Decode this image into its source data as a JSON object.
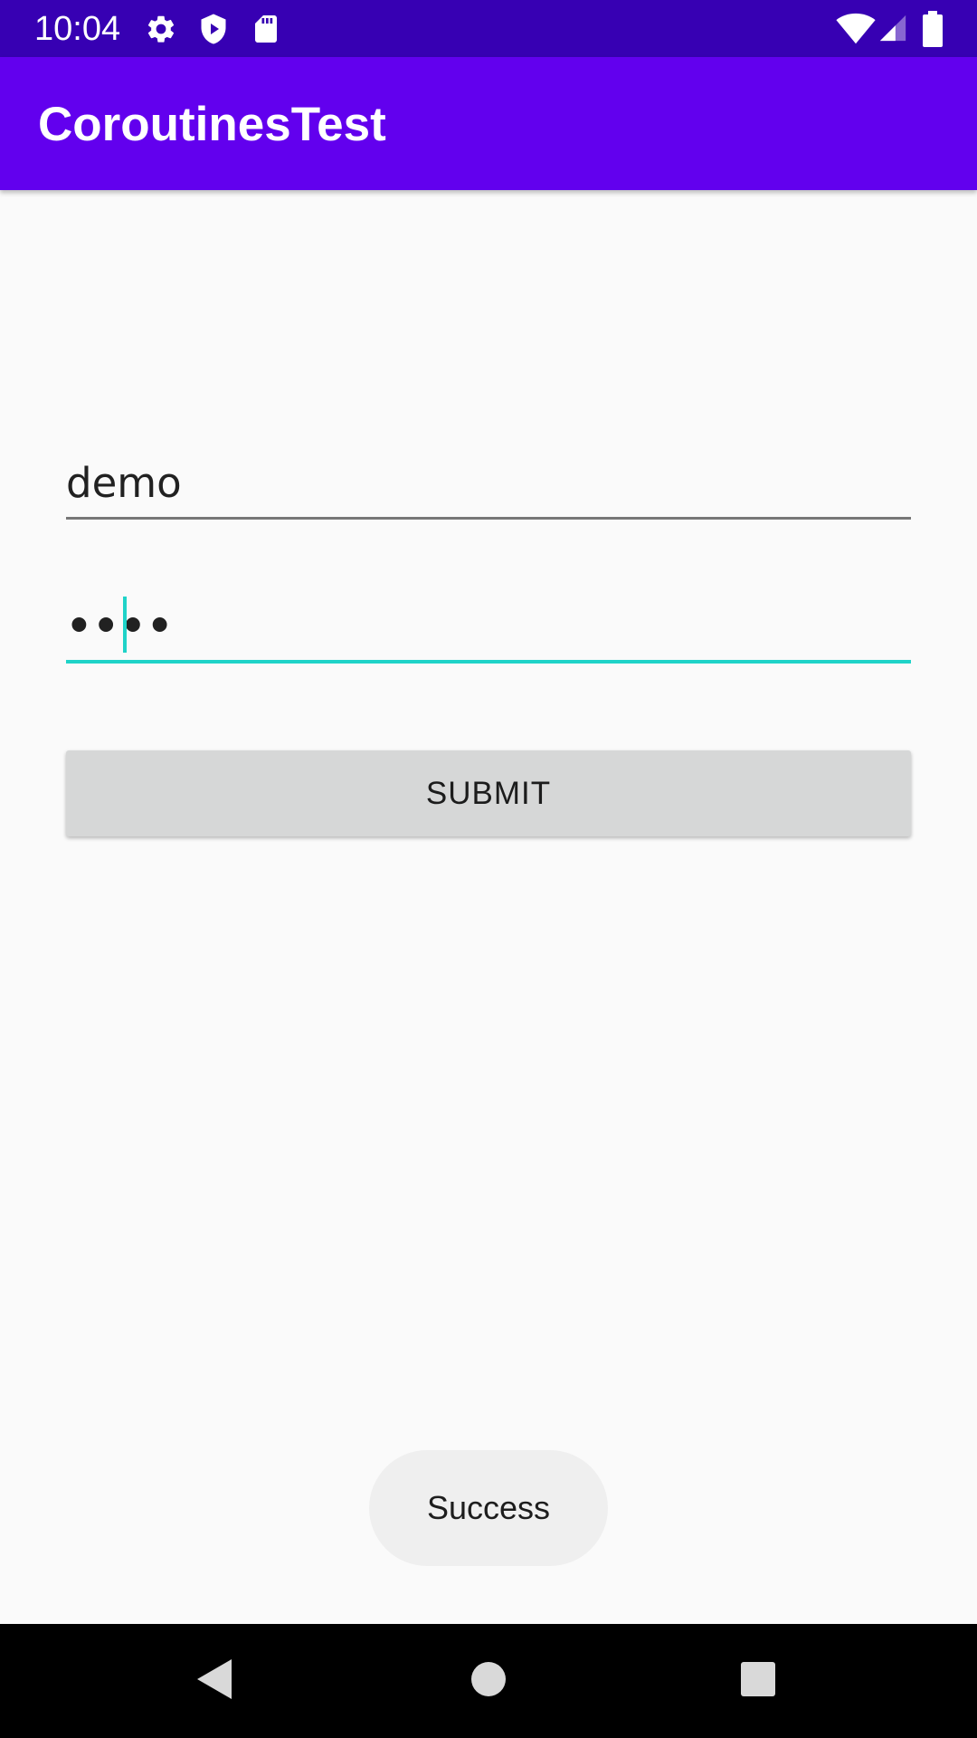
{
  "status_bar": {
    "time": "10:04",
    "left_icons": [
      "gear-icon",
      "shield-play-icon",
      "sd-card-icon"
    ],
    "right_icons": [
      "wifi-icon",
      "cell-signal-icon",
      "battery-icon"
    ]
  },
  "app_bar": {
    "title": "CoroutinesTest",
    "color": "#6200ee",
    "status_color": "#3700b3"
  },
  "form": {
    "username_value": "demo",
    "password_value": "••••",
    "password_focused": true,
    "accent_color": "#1fd3c8",
    "submit_label": "SUBMIT"
  },
  "toast": {
    "message": "Success"
  },
  "nav_bar": {
    "buttons": [
      "back-icon",
      "home-icon",
      "recents-icon"
    ]
  }
}
